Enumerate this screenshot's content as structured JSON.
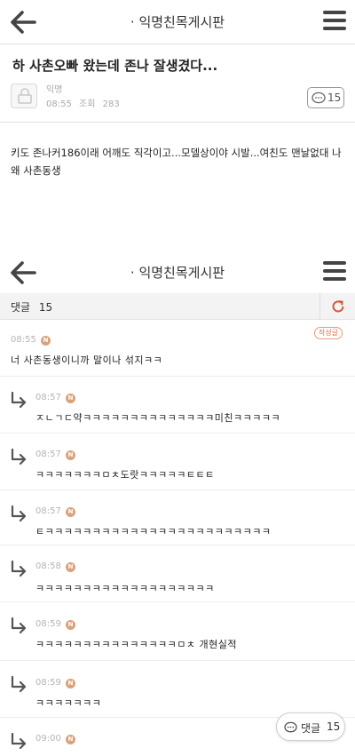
{
  "header": {
    "title": "· 익명친목게시판"
  },
  "post": {
    "title": "하 사촌오빠 왔는데 존나 잘생겼다...",
    "author": "익명",
    "time": "08:55",
    "views_label": "조회",
    "views": "283",
    "comment_count": "15",
    "body": "키도 존나커186이래 어깨도 직각이고...모델상이야 시발...여친도 맨날없대 나 왜 사촌동생"
  },
  "comments_header": {
    "label": "댓글",
    "count": "15"
  },
  "comments": [
    {
      "time": "08:55",
      "badge": "N",
      "text": "너 사촌동생이니까 말이나 섞지ㅋㅋ",
      "op_tag": "작성글"
    },
    {
      "time": "08:57",
      "badge": "N",
      "text": "ㅈㄴㄱㄷ약ㅋㅋㅋㅋㅋㅋㅋㅋㅋㅋㅋㅋㅋㅋ미친ㅋㅋㅋㅋㅋ"
    },
    {
      "time": "08:57",
      "badge": "N",
      "text": "ㅋㅋㅋㅋㅋㅋㅋㅁㅊ도랏ㅋㅋㅋㅋㅋㅌㅌㅌ"
    },
    {
      "time": "08:57",
      "badge": "N",
      "text": "ㅌㅋㅋㅋㅋㅋㅋㅋㅋㅋㅋㅋㅋㅋㅋㅋㅋㅋㅋㅋㅋㅋㅋㅋㅋ"
    },
    {
      "time": "08:58",
      "badge": "N",
      "text": "ㅋㅋㅋㅋㅋㅋㅋㅋㅋㅋㅋㅋㅋㅋㅋㅋㅋㅋㅋ"
    },
    {
      "time": "08:59",
      "badge": "N",
      "text": "ㅋㅋㅋㅋㅋㅋㅋㅋㅋㅋㅋㅋㅋㅋㅋㅁㅊ 개현실적"
    },
    {
      "time": "08:59",
      "badge": "N",
      "text": "ㅋㅋㅋㅋㅋㅋㅋ"
    },
    {
      "time": "09:00",
      "badge": "N",
      "text": ""
    }
  ],
  "float_button": {
    "label": "댓글",
    "count": "15"
  }
}
